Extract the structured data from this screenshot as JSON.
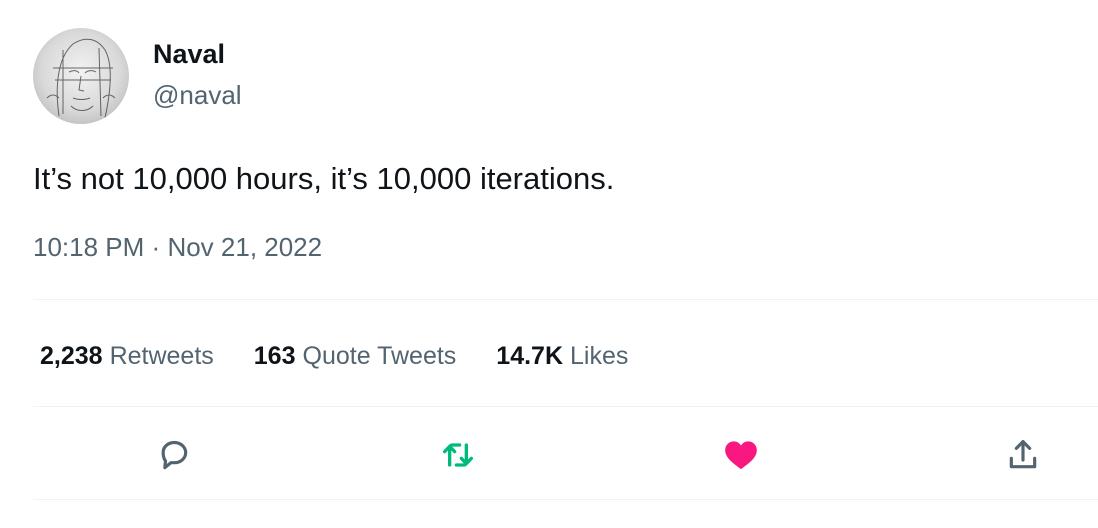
{
  "author": {
    "display_name": "Naval",
    "handle": "@naval"
  },
  "tweet": {
    "text": "It’s not 10,000 hours, it’s 10,000 iterations.",
    "time": "10:18 PM",
    "separator": "·",
    "date": "Nov 21, 2022"
  },
  "stats": {
    "retweets_count": "2,238",
    "retweets_label": "Retweets",
    "quotes_count": "163",
    "quotes_label": "Quote Tweets",
    "likes_count": "14.7K",
    "likes_label": "Likes"
  },
  "actions": {
    "reply_icon": "reply-icon",
    "retweet_icon": "retweet-icon",
    "like_icon": "heart-icon",
    "share_icon": "share-icon"
  },
  "colors": {
    "text_primary": "#0f1419",
    "text_secondary": "#536471",
    "retweet_active": "#00ba7c",
    "like_active": "#f91880",
    "divider": "#eff3f4"
  }
}
